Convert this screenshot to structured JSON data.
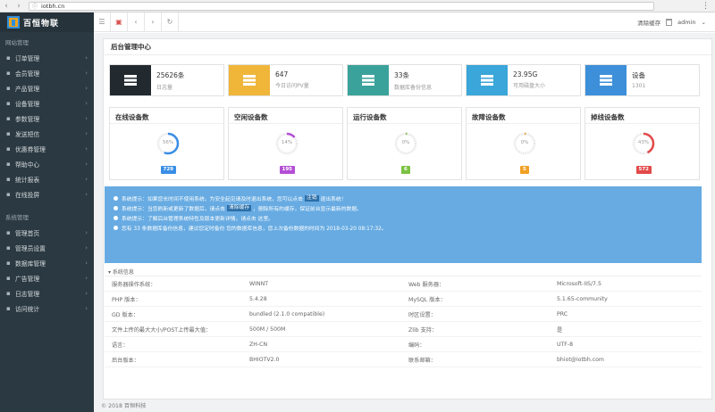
{
  "browser": {
    "url": "iotbh.cn",
    "info_icon": "info-icon"
  },
  "sidebar": {
    "logo_text": "百恒物联",
    "section1": "网站管理",
    "section1_items": [
      {
        "label": "订单管理",
        "icon": "list-icon"
      },
      {
        "label": "会员管理",
        "icon": "user-icon"
      },
      {
        "label": "产品管理",
        "icon": "box-icon"
      },
      {
        "label": "设备管理",
        "icon": "device-icon"
      },
      {
        "label": "参数管理",
        "icon": "gear-icon"
      },
      {
        "label": "发送短信",
        "icon": "message-icon"
      },
      {
        "label": "优惠券管理",
        "icon": "coupon-icon"
      },
      {
        "label": "帮助中心",
        "icon": "help-icon"
      },
      {
        "label": "统计报表",
        "icon": "chart-icon"
      },
      {
        "label": "在线投屏",
        "icon": "screen-icon"
      }
    ],
    "section2": "系统管理",
    "section2_items": [
      {
        "label": "管理首页",
        "icon": "home-icon"
      },
      {
        "label": "管理员设置",
        "icon": "admin-icon"
      },
      {
        "label": "数据库管理",
        "icon": "database-icon"
      },
      {
        "label": "广告管理",
        "icon": "ad-icon"
      },
      {
        "label": "日志管理",
        "icon": "log-icon"
      },
      {
        "label": "访问统计",
        "icon": "stats-icon"
      }
    ]
  },
  "topbar": {
    "clear_cache": "清除缓存",
    "user": "admin"
  },
  "panel": {
    "title": "后台管理中心"
  },
  "stats": [
    {
      "value": "25626条",
      "label": "日志量",
      "color": "#222a30",
      "icon": "server-icon"
    },
    {
      "value": "647",
      "label": "今日访问PV量",
      "color": "#f0b63a",
      "icon": "bar-chart-icon"
    },
    {
      "value": "33条",
      "label": "数据库备份信息",
      "color": "#3aa29a",
      "icon": "database-icon"
    },
    {
      "value": "23.95G",
      "label": "可用磁盘大小",
      "color": "#3aa6d9",
      "icon": "disk-icon"
    },
    {
      "value": "设备",
      "label": "1301",
      "color": "#3d8fd9",
      "icon": "joomla-icon"
    }
  ],
  "devices": [
    {
      "title": "在线设备数",
      "percent": "56%",
      "pct_value": 56,
      "count": "729",
      "color": "#3a8ee6"
    },
    {
      "title": "空闲设备数",
      "percent": "14%",
      "pct_value": 14,
      "count": "195",
      "color": "#b44fd6"
    },
    {
      "title": "运行设备数",
      "percent": "0%",
      "pct_value": 0,
      "count": "6",
      "color": "#7cc243"
    },
    {
      "title": "故障设备数",
      "percent": "0%",
      "pct_value": 0,
      "count": "5",
      "color": "#f2a125"
    },
    {
      "title": "掉线设备数",
      "percent": "43%",
      "pct_value": 43,
      "count": "572",
      "color": "#e24a4a"
    }
  ],
  "notice": {
    "l1_a": "系统提示：如果您长时间不使用系统，为安全起见请及时退出系统，您可以点击",
    "l1_hl": "注销",
    "l1_b": "退出系统！",
    "l2_a": "系统提示：当您刷新或更新了数据后，请点击",
    "l2_hl": "清除缓存",
    "l2_b": "，删除所有的缓存，保证前台显示最新的数据。",
    "l3": "系统提示：了解后台管理系统特性及版本更新详情，请点击 这里。",
    "l4": "您有 33 条数据库备份信息，建议您定时备份 您的数据库信息，您上次备份数据的时间为 2018-03-20 08:17:32。"
  },
  "sysinfo_title": "系统信息",
  "sysinfo": [
    {
      "k1": "服务器操作系统：",
      "v1": "WINNT",
      "k2": "Web 服务器：",
      "v2": "Microsoft-IIS/7.5"
    },
    {
      "k1": "PHP 版本：",
      "v1": "5.4.28",
      "k2": "MySQL 版本：",
      "v2": "5.1.65-community"
    },
    {
      "k1": "GD 版本：",
      "v1": "bundled (2.1.0 compatible)",
      "k2": "时区设置：",
      "v2": "PRC"
    },
    {
      "k1": "文件上传的最大大小/POST上传最大值：",
      "v1": "500M / 500M",
      "k2": "Zlib 支持：",
      "v2": "是"
    },
    {
      "k1": "语言：",
      "v1": "ZH-CN",
      "k2": "编码：",
      "v2": "UTF-8"
    },
    {
      "k1": "后台版本：",
      "v1": "BHIOTV2.0",
      "k2": "联系邮箱：",
      "v2": "bhiot@iotbh.com"
    }
  ],
  "footer": "© 2018 百恒科技"
}
